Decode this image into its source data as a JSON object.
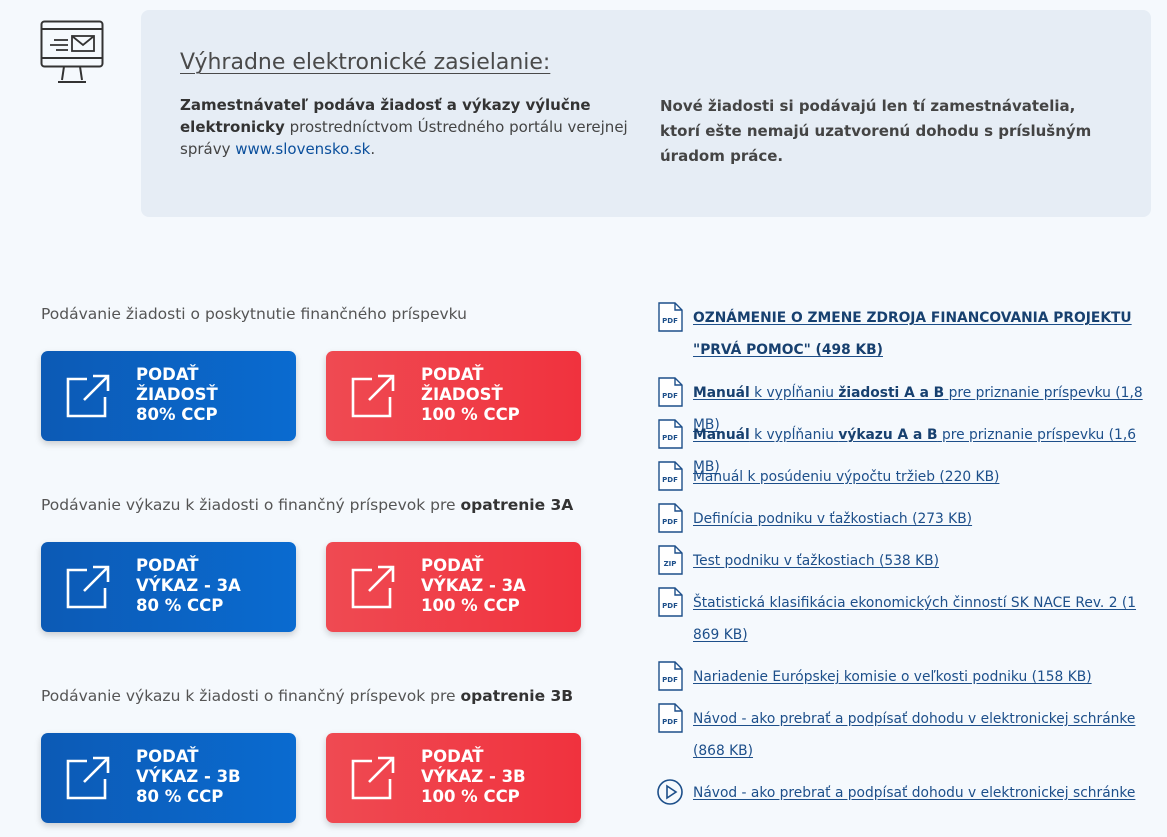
{
  "info": {
    "title": "Výhradne elektronické zasielanie:",
    "left_bold": "Zamestnávateľ podáva žiadosť a výkazy výlučne elektronicky",
    "left_text": " prostredníctvom Ústredného portálu verejnej správy ",
    "left_link": "www.slovensko.sk",
    "left_end": ".",
    "right_text": "Nové žiadosti si podávajú len tí zamestnávatelia, ktorí ešte nemajú uzatvorenú dohodu s príslušným úradom práce."
  },
  "sections": [
    {
      "label": "Podávanie žiadosti o poskytnutie finančného príspevku",
      "label_bold": "",
      "buttons": [
        {
          "lines": [
            "PODAŤ",
            "ŽIADOSŤ",
            "80% CCP"
          ]
        },
        {
          "lines": [
            "PODAŤ",
            "ŽIADOSŤ",
            "100 % CCP"
          ]
        }
      ]
    },
    {
      "label": "Podávanie výkazu k žiadosti o finančný príspevok pre ",
      "label_bold": "opatrenie 3A",
      "buttons": [
        {
          "lines": [
            "PODAŤ",
            "VÝKAZ - 3A",
            "80 % CCP"
          ]
        },
        {
          "lines": [
            "PODAŤ",
            "VÝKAZ - 3A",
            "100 % CCP"
          ]
        }
      ]
    },
    {
      "label": "Podávanie výkazu k žiadosti o finančný príspevok pre ",
      "label_bold": "opatrenie 3B",
      "buttons": [
        {
          "lines": [
            "PODAŤ",
            "VÝKAZ - 3B",
            "80 % CCP"
          ]
        },
        {
          "lines": [
            "PODAŤ",
            "VÝKAZ - 3B",
            "100 % CCP"
          ]
        }
      ]
    }
  ],
  "documents": [
    {
      "icon": "pdf-icon",
      "parts": [
        {
          "b": "OZNÁMENIE O ZMENE ZDROJA FINANCOVANIA PROJEKTU \"PRVÁ POMOC\" (498 KB)"
        }
      ]
    },
    {
      "icon": "pdf-icon",
      "parts": [
        {
          "b": "Manuál"
        },
        {
          "t": " k vypĺňaniu "
        },
        {
          "b": "žiadosti A a B"
        },
        {
          "t": " pre priznanie príspevku (1,8 MB)"
        }
      ]
    },
    {
      "icon": "pdf-icon",
      "parts": [
        {
          "b": "Manuál"
        },
        {
          "t": " k vypĺňaniu "
        },
        {
          "b": "výkazu A a B"
        },
        {
          "t": " pre priznanie príspevku (1,6 MB)"
        }
      ]
    },
    {
      "icon": "pdf-icon",
      "parts": [
        {
          "t": "Manuál k posúdeniu výpočtu tržieb (220 KB)"
        }
      ]
    },
    {
      "icon": "pdf-icon",
      "parts": [
        {
          "t": "Definícia podniku v ťažkostiach (273 KB)"
        }
      ]
    },
    {
      "icon": "zip-icon",
      "parts": [
        {
          "t": "Test podniku v ťažkostiach (538 KB)"
        }
      ]
    },
    {
      "icon": "pdf-icon",
      "parts": [
        {
          "t": "Štatistická klasifikácia ekonomických činností SK NACE Rev. 2 (1 869 KB)"
        }
      ]
    },
    {
      "icon": "pdf-icon",
      "parts": [
        {
          "t": "Nariadenie Európskej komisie o veľkosti podniku (158 KB)"
        }
      ]
    },
    {
      "icon": "pdf-icon",
      "parts": [
        {
          "t": "Návod - ako prebrať a podpísať dohodu v elektronickej schránke (868 KB)"
        }
      ]
    },
    {
      "icon": "play-icon",
      "parts": [
        {
          "t": "Návod - ako prebrať a podpísať dohodu v elektronickej schránke"
        }
      ]
    }
  ],
  "colors": {
    "blue_button": "#0b5fc0",
    "red_button": "#f03c45",
    "link": "#1d4f8a",
    "info_background": "#e6edf5"
  }
}
